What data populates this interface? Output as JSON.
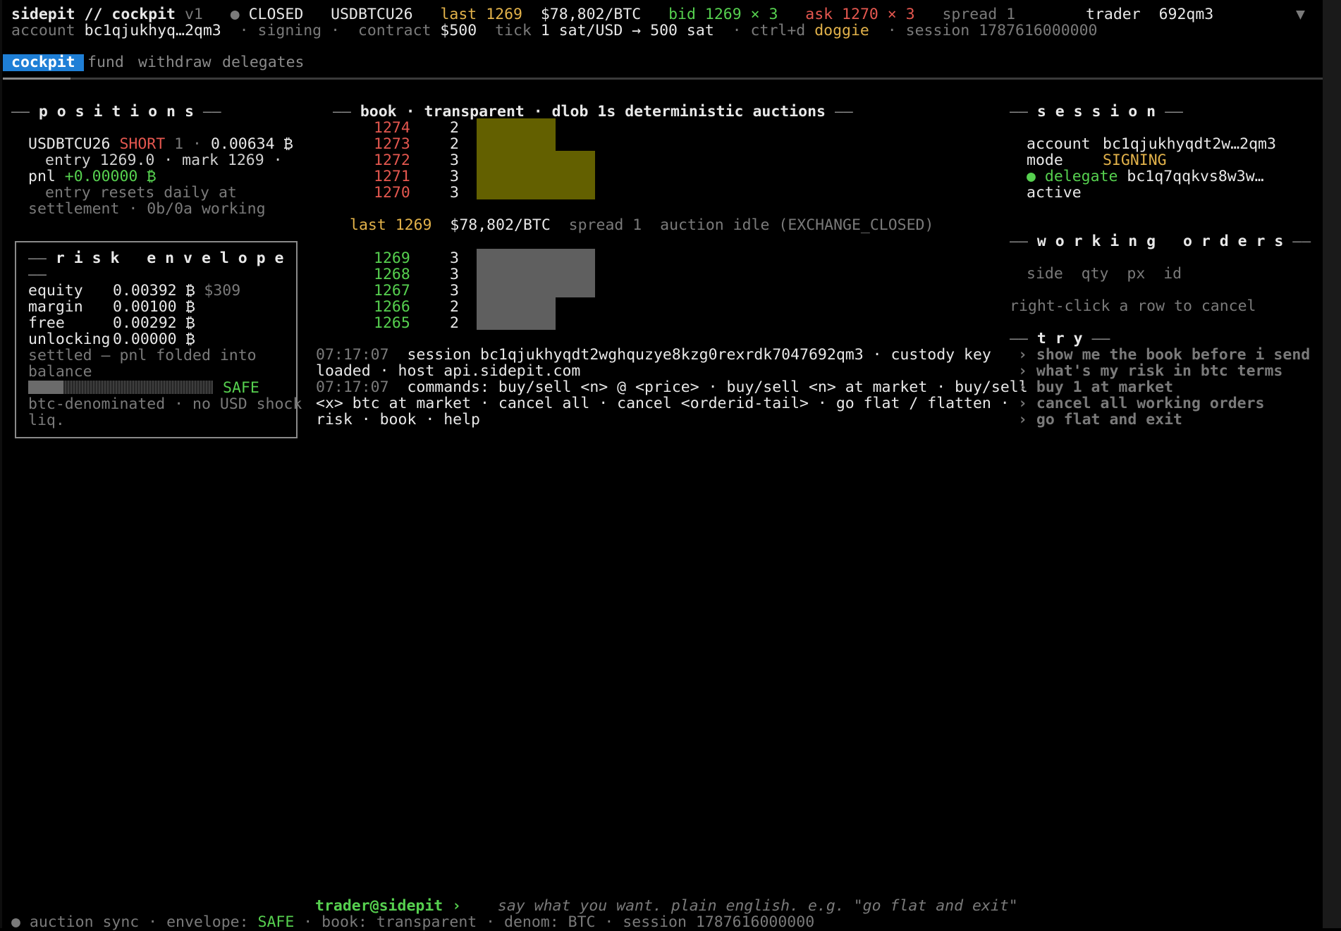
{
  "header": {
    "app": "sidepit // cockpit",
    "version": "v1",
    "status_dot": "●",
    "status": "CLOSED",
    "contract_sym": "USDBTCU26",
    "last_label": "last",
    "last_value": "1269",
    "btc_price": "$78,802/BTC",
    "bid": "bid 1269 × 3",
    "ask": "ask 1270 × 3",
    "spread": "spread 1",
    "trader_label": "trader",
    "trader_value": "692qm3",
    "menu_glyph": "▼"
  },
  "subheader": {
    "account_label": "account",
    "account_value": "bc1qjukhyq…2qm3",
    "signing": "· signing ·",
    "contract_label": "contract",
    "contract_value": "$500",
    "tick_label": "tick",
    "tick_value": "1 sat/USD → 500 sat",
    "ctrl": "· ctrl+d",
    "ctrl_name": "doggie",
    "session": "· session 1787616000000"
  },
  "tabs": [
    "cockpit",
    "fund",
    "withdraw",
    "delegates"
  ],
  "positions": {
    "title": "p o s i t i o n s",
    "sym": "USDBTCU26",
    "side": "SHORT",
    "qty": "1",
    "sep": "·",
    "size": "0.00634 ₿",
    "entry_line": "entry 1269.0 · mark 1269 ·",
    "pnl_label": "pnl",
    "pnl_value": "+0.00000 ₿",
    "note1": "entry resets daily at",
    "note2": "settlement · 0b/0a working"
  },
  "risk": {
    "title": "r i s k   e n v e l o p e",
    "rows": [
      {
        "label": "equity",
        "value": "0.00392 ₿",
        "extra": "$309"
      },
      {
        "label": "margin",
        "value": "0.00100 ₿",
        "extra": ""
      },
      {
        "label": "free",
        "value": "0.00292 ₿",
        "extra": ""
      },
      {
        "label": "unlocking",
        "value": "0.00000 ₿",
        "extra": ""
      }
    ],
    "settled1": "settled — pnl folded into",
    "settled2": "balance",
    "level": 0.19,
    "state": "SAFE",
    "foot1": "btc-denominated · no USD shock",
    "foot2": "liq."
  },
  "book": {
    "title": "book · transparent · dlob 1s deterministic auctions",
    "asks": [
      {
        "px": "1274",
        "qty": "2"
      },
      {
        "px": "1273",
        "qty": "2"
      },
      {
        "px": "1272",
        "qty": "3"
      },
      {
        "px": "1271",
        "qty": "3"
      },
      {
        "px": "1270",
        "qty": "3"
      }
    ],
    "bids": [
      {
        "px": "1269",
        "qty": "3"
      },
      {
        "px": "1268",
        "qty": "3"
      },
      {
        "px": "1267",
        "qty": "3"
      },
      {
        "px": "1266",
        "qty": "2"
      },
      {
        "px": "1265",
        "qty": "2"
      }
    ],
    "mid_last": "last 1269",
    "mid_price": "$78,802/BTC",
    "mid_spread": "spread 1",
    "mid_auction": "auction idle (EXCHANGE_CLOSED)"
  },
  "log": [
    {
      "time": "07:17:07",
      "text": "session bc1qjukhyqdt2wghquzye8kzg0rexrdk7047692qm3 · custody key",
      "cont": "loaded · host api.sidepit.com"
    },
    {
      "time": "07:17:07",
      "text": "commands: buy/sell <n> @ <price> · buy/sell <n> at market · buy/sell",
      "cont": "<x> btc at market · cancel all · cancel <orderid-tail> · go flat / flatten ·",
      "cont2": "risk · book · help"
    }
  ],
  "session": {
    "title": "s e s s i o n",
    "account_label": "account",
    "account_value": "bc1qjukhyqdt2w…2qm3",
    "mode_label": "mode",
    "mode_value": "SIGNING",
    "delegate_dot": "●",
    "delegate_label": "delegate",
    "delegate_value": "bc1q7qqkvs8w3w…",
    "active": "active"
  },
  "orders": {
    "title": "w o r k i n g   o r d e r s",
    "cols": [
      "side",
      "qty",
      "px",
      "id"
    ],
    "hint": "right-click a row to cancel"
  },
  "try": {
    "title": "t r y",
    "items": [
      "show me the book before i send",
      "what's my risk in btc terms",
      "buy 1 at market",
      "cancel all working orders",
      "go flat and exit"
    ]
  },
  "prompt": {
    "label": "trader@sidepit ›",
    "placeholder": "say what you want. plain english. e.g. \"go flat and exit\""
  },
  "statusbar": {
    "dot": "●",
    "text1": "auction sync · envelope:",
    "state": "SAFE",
    "text2": "· book: transparent · denom: BTC · session 1787616000000"
  },
  "colors": {
    "accent": "#1f7fd6",
    "ask": "#e4574f",
    "bid": "#56d04f",
    "ask_bar": "#636000",
    "bid_bar": "#5f5f5f",
    "warn": "#e2b24a"
  }
}
